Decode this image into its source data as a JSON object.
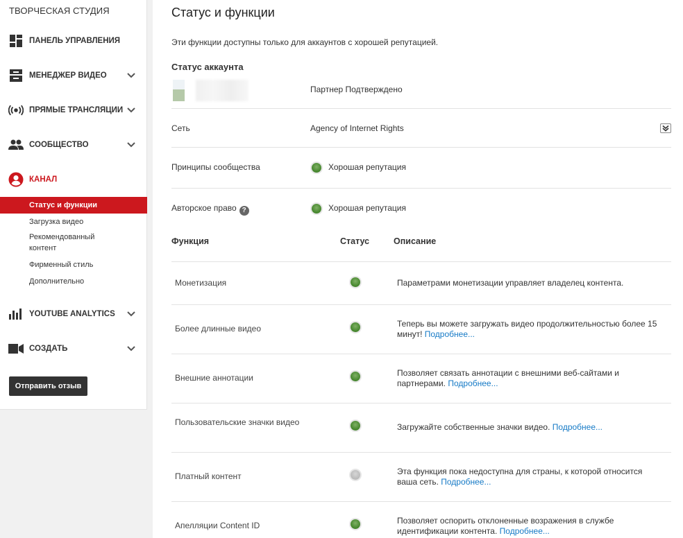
{
  "sidebar": {
    "studio_title": "ТВОРЧЕСКАЯ СТУДИЯ",
    "nav": [
      {
        "id": "dashboard",
        "label": "ПАНЕЛЬ УПРАВЛЕНИЯ",
        "icon": "dashboard-icon",
        "has_chevron": false
      },
      {
        "id": "video-manager",
        "label": "МЕНЕДЖЕР ВИДЕО",
        "icon": "video-manager-icon",
        "has_chevron": true
      },
      {
        "id": "live",
        "label": "ПРЯМЫЕ ТРАНСЛЯЦИИ",
        "icon": "live-broadcast-icon",
        "has_chevron": true
      },
      {
        "id": "community",
        "label": "СООБЩЕСТВО",
        "icon": "community-icon",
        "has_chevron": true
      },
      {
        "id": "channel",
        "label": "КАНАЛ",
        "icon": "channel-icon",
        "has_chevron": false,
        "active": true
      },
      {
        "id": "analytics",
        "label": "YOUTUBE ANALYTICS",
        "icon": "analytics-icon",
        "has_chevron": true
      },
      {
        "id": "create",
        "label": "СОЗДАТЬ",
        "icon": "create-camera-icon",
        "has_chevron": true
      }
    ],
    "channel_sub": [
      {
        "label": "Статус и функции",
        "active": true
      },
      {
        "label": "Загрузка видео"
      },
      {
        "label": "Рекомендованный контент"
      },
      {
        "label": "Фирменный стиль"
      },
      {
        "label": "Дополнительно"
      }
    ],
    "feedback_label": "Отправить отзыв"
  },
  "main": {
    "title": "Статус и функции",
    "intro": "Эти функции доступны только для аккаунтов с хорошей репутацией.",
    "account_status_heading": "Статус аккаунта",
    "account_status_value": "Партнер Подтверждено",
    "network_label": "Сеть",
    "network_value": "Agency of Internet Rights",
    "community_label": "Принципы сообщества",
    "community_value": "Хорошая репутация",
    "copyright_label": "Авторское право",
    "copyright_help": "?",
    "copyright_value": "Хорошая репутация",
    "status_colors": {
      "good": "#4a8a32",
      "unavailable": "#bdbdbd"
    },
    "table": {
      "headers": [
        "Функция",
        "Статус",
        "Описание"
      ],
      "rows": [
        {
          "name": "Монетизация",
          "status": "good",
          "desc": "Параметрами монетизации управляет владелец контента.",
          "link": ""
        },
        {
          "name": "Более длинные видео",
          "status": "good",
          "desc": "Теперь вы можете загружать видео продолжительностью более 15 минут!",
          "link": "Подробнее..."
        },
        {
          "name": "Внешние аннотации",
          "status": "good",
          "desc": "Позволяет связать аннотации с внешними веб-сайтами и партнерами.",
          "link": "Подробнее..."
        },
        {
          "name": "Пользовательские значки видео",
          "status": "good",
          "desc": "Загружайте собственные значки видео.",
          "link": "Подробнее..."
        },
        {
          "name": "Платный контент",
          "status": "unavailable",
          "desc": "Эта функция пока недоступна для страны, к которой относится ваша сеть.",
          "link": "Подробнее..."
        },
        {
          "name": "Апелляции Content ID",
          "status": "good",
          "desc": "Позволяет оспорить отклоненные возражения в службе идентификации контента.",
          "link": "Подробнее..."
        }
      ]
    }
  }
}
